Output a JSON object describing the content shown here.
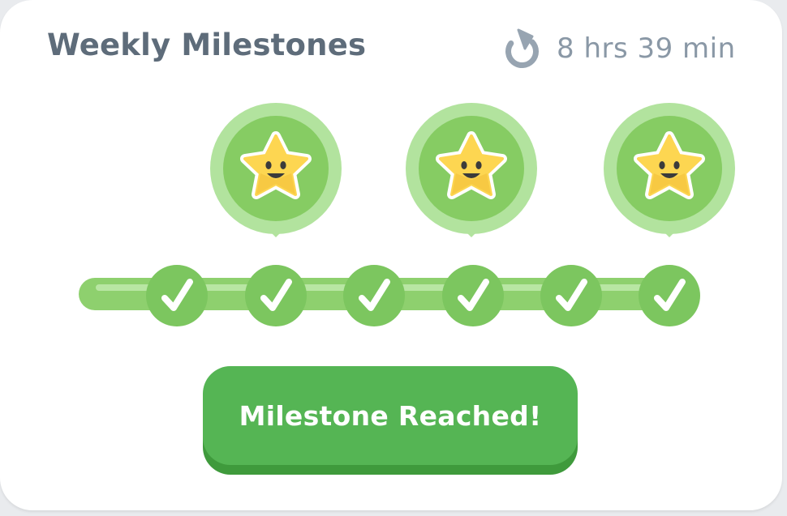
{
  "card": {
    "title": "Weekly Milestones",
    "timer": {
      "icon": "refresh-icon",
      "text": "8 hrs 39 min"
    }
  },
  "milestones": {
    "steps": [
      {
        "status": "completed",
        "icon": "check-icon"
      },
      {
        "status": "completed",
        "icon": "check-icon"
      },
      {
        "status": "completed",
        "icon": "check-icon"
      },
      {
        "status": "completed",
        "icon": "check-icon"
      },
      {
        "status": "completed",
        "icon": "check-icon"
      },
      {
        "status": "completed",
        "icon": "check-icon"
      }
    ],
    "rewards": [
      {
        "after_step": 2,
        "icon": "smiling-star-icon"
      },
      {
        "after_step": 4,
        "icon": "smiling-star-icon"
      },
      {
        "after_step": 6,
        "icon": "smiling-star-icon"
      }
    ]
  },
  "action": {
    "label": "Milestone Reached!"
  },
  "colors": {
    "title": "#5e6c7a",
    "timer": "#8a98a6",
    "track": "#8ed06e",
    "node": "#7cc65f",
    "badge_outer": "#b2e39e",
    "badge_inner": "#86cc63",
    "star": "#fdd651",
    "button": "#55b554",
    "button_shadow": "#3f9a3c"
  }
}
